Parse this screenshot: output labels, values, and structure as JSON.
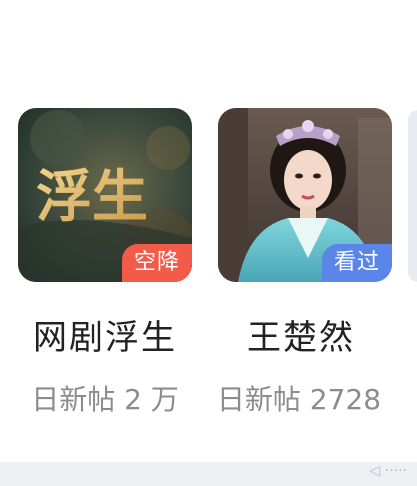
{
  "cards": [
    {
      "name": "网剧浮生",
      "badge": "空降",
      "stat": "日新帖 2 万",
      "thumb_title": "浮生",
      "badge_color": "#f15b47"
    },
    {
      "name": "王楚然",
      "badge": "看过",
      "stat": "日新帖 2728",
      "badge_color": "#5a86ea"
    }
  ],
  "watermark": "◁ ·····"
}
